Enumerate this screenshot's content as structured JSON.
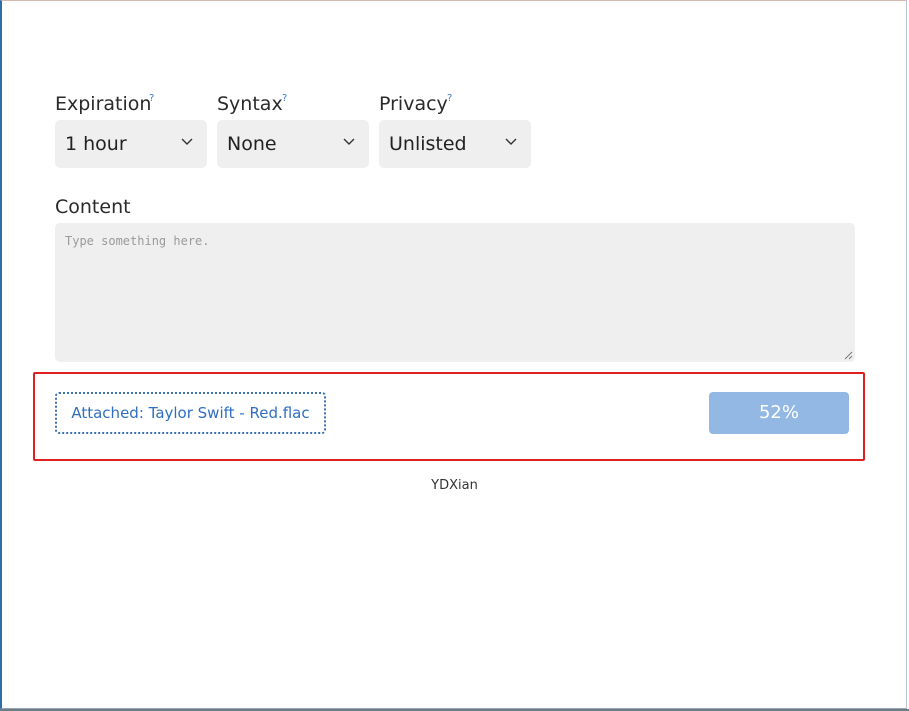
{
  "form": {
    "expiration": {
      "label": "Expiration",
      "help": "?",
      "value": "1 hour"
    },
    "syntax": {
      "label": "Syntax",
      "help": "?",
      "value": "None"
    },
    "privacy": {
      "label": "Privacy",
      "help": "?",
      "value": "Unlisted"
    },
    "content": {
      "label": "Content",
      "placeholder": "Type something here."
    }
  },
  "upload": {
    "attached_label": "Attached: Taylor Swift - Red.flac",
    "progress_label": "52%",
    "progress_percent": 52
  },
  "footer": {
    "text": "YDXian"
  },
  "colors": {
    "accent": "#3a72b8",
    "progress": "#93b8e4",
    "highlight": "#e02020",
    "field_bg": "#efefef"
  },
  "icons": {
    "select_chevron": "chevron-down-icon",
    "textarea_grip": "resize-grip-icon"
  }
}
